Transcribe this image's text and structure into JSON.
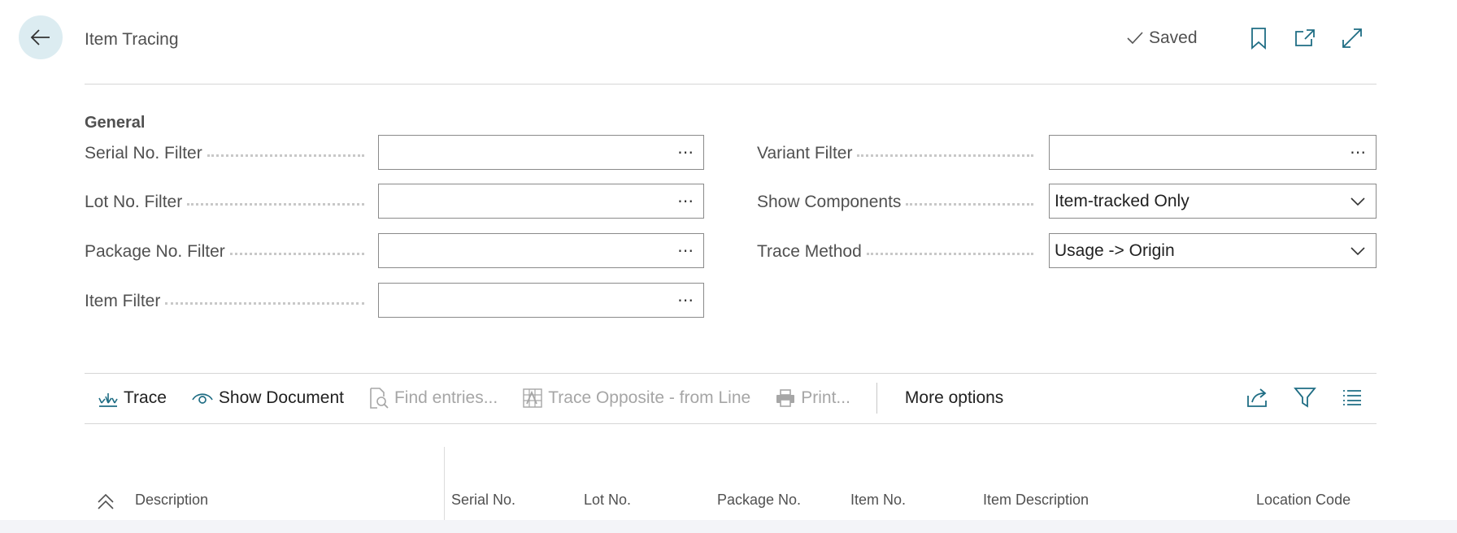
{
  "header": {
    "title": "Item Tracing",
    "saved_label": "Saved"
  },
  "general": {
    "section_title": "General",
    "left_fields": [
      {
        "label": "Serial No. Filter",
        "value": ""
      },
      {
        "label": "Lot No. Filter",
        "value": ""
      },
      {
        "label": "Package No. Filter",
        "value": ""
      },
      {
        "label": "Item Filter",
        "value": ""
      }
    ],
    "right_fields": [
      {
        "label": "Variant Filter",
        "value": ""
      },
      {
        "label": "Show Components",
        "value": "Item-tracked Only"
      },
      {
        "label": "Trace Method",
        "value": "Usage -> Origin"
      }
    ]
  },
  "actions": {
    "trace": "Trace",
    "show_document": "Show Document",
    "find_entries": "Find entries...",
    "trace_opposite": "Trace Opposite - from Line",
    "print": "Print...",
    "more_options": "More options"
  },
  "columns": {
    "description": "Description",
    "serial_no": "Serial No.",
    "lot_no": "Lot No.",
    "package_no": "Package No.",
    "item_no": "Item No.",
    "item_description": "Item Description",
    "location_code": "Location Code"
  },
  "icons": {
    "accent": "#1f6d84",
    "disabled": "#a6a6a6"
  }
}
